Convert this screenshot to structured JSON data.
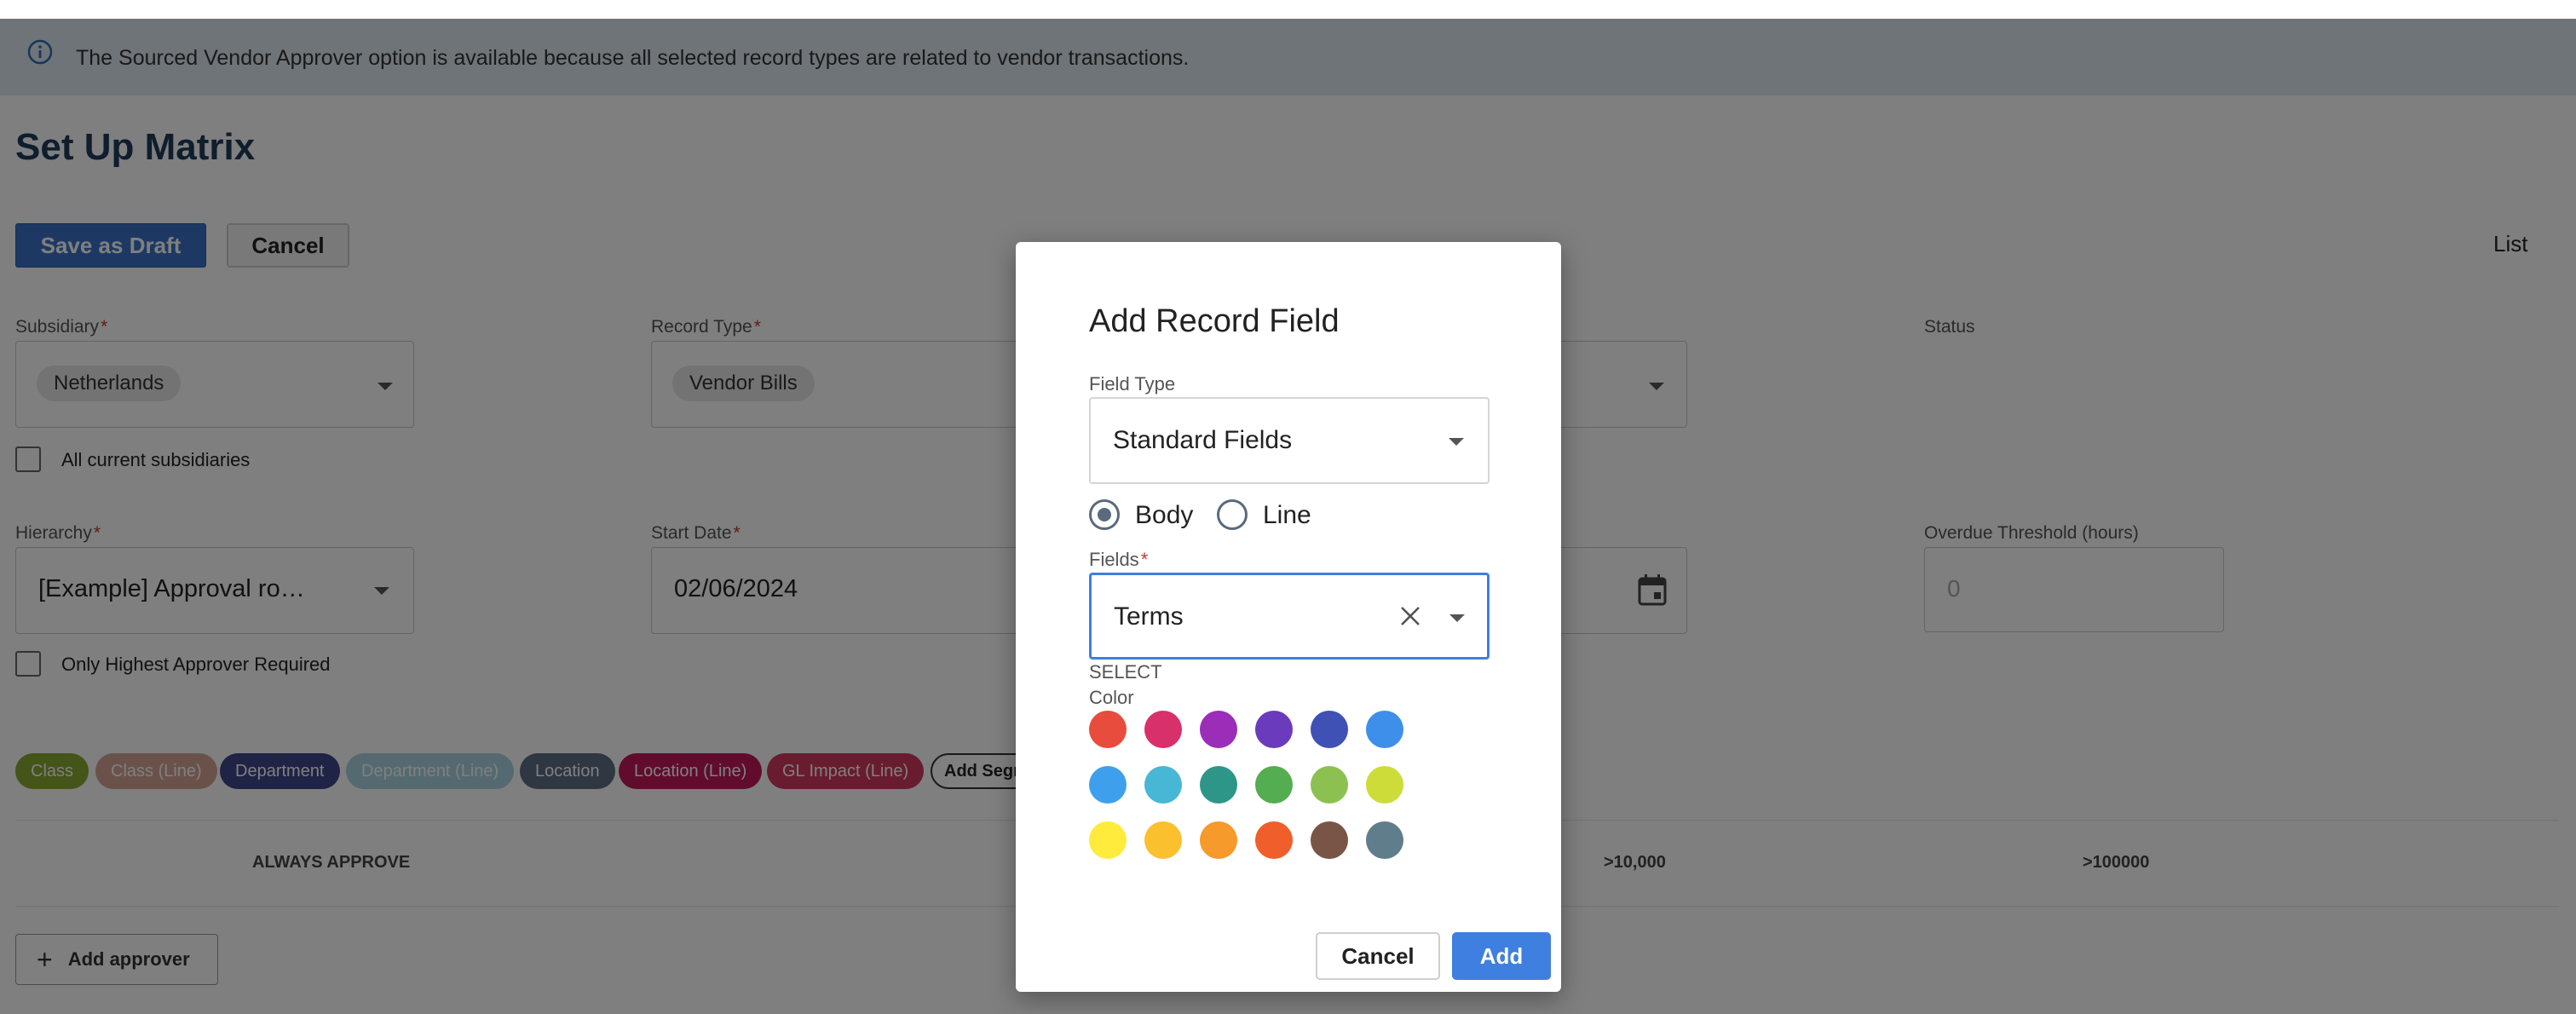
{
  "banner": {
    "message": "The Sourced Vendor Approver option is available because all selected record types are related to vendor transactions."
  },
  "page": {
    "title": "Set Up Matrix",
    "save_draft_label": "Save as Draft",
    "cancel_label": "Cancel",
    "list_link": "List"
  },
  "form": {
    "subsidiary": {
      "label": "Subsidiary",
      "value": "Netherlands"
    },
    "record_type": {
      "label": "Record Type",
      "value": "Vendor Bills"
    },
    "status": {
      "label": "Status"
    },
    "all_subsidiaries_label": "All current subsidiaries",
    "hierarchy": {
      "label": "Hierarchy",
      "value": "[Example] Approval ro…"
    },
    "start_date": {
      "label": "Start Date",
      "value": "02/06/2024"
    },
    "overdue": {
      "label": "Overdue Threshold (hours)",
      "placeholder": "0"
    },
    "only_highest_label": "Only Highest Approver Required"
  },
  "segments": [
    {
      "label": "Class",
      "color": "#8aa832"
    },
    {
      "label": "Class (Line)",
      "color": "#d4a596"
    },
    {
      "label": "Department",
      "color": "#3f478a"
    },
    {
      "label": "Department (Line)",
      "color": "#a9d4e0"
    },
    {
      "label": "Location",
      "color": "#5e6e86"
    },
    {
      "label": "Location (Line)",
      "color": "#c2185b"
    },
    {
      "label": "GL Impact (Line)",
      "color": "#d2395f"
    }
  ],
  "add_segment_label": "Add Segm",
  "table": {
    "headers": [
      "ALWAYS APPROVE",
      ">10,000",
      ">100000"
    ]
  },
  "add_approver_label": "Add approver",
  "dialog": {
    "title": "Add Record Field",
    "field_type_label": "Field Type",
    "field_type_value": "Standard Fields",
    "radio_body": "Body",
    "radio_line": "Line",
    "fields_label": "Fields",
    "fields_value": "Terms",
    "select_text": "SELECT",
    "color_label": "Color",
    "colors": [
      "#e74c3c",
      "#d8306a",
      "#9b2db8",
      "#6a3bbd",
      "#3f51b5",
      "#3d8fe9",
      "#3ea0ec",
      "#48b7d6",
      "#2e9688",
      "#55ad52",
      "#8cc152",
      "#cddc39",
      "#ffeb3b",
      "#fbc02d",
      "#f59a2b",
      "#f05f2b",
      "#795548",
      "#607d8b"
    ],
    "cancel_label": "Cancel",
    "add_label": "Add"
  }
}
